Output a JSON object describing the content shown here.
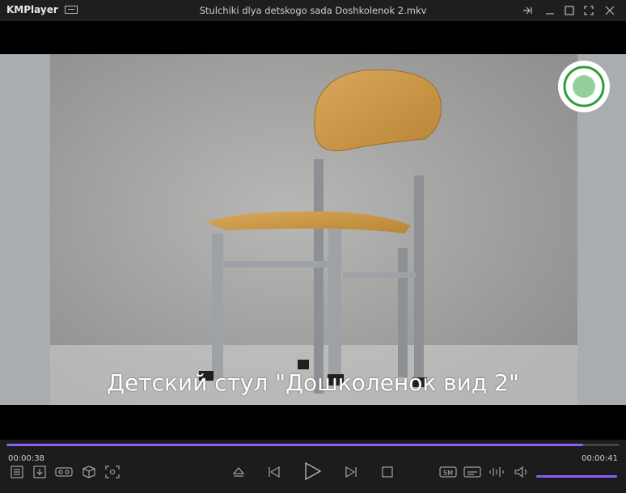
{
  "app": {
    "name": "KMPlayer",
    "file_title": "Stulchiki dlya detskogo sada Doshkolenok 2.mkv"
  },
  "video": {
    "subtitle": "Детский стул \"Дошколенок вид 2\""
  },
  "playback": {
    "elapsed": "00:00:38",
    "remaining": "00:00:41",
    "progress": 0.94,
    "volume": 1.0
  },
  "colors": {
    "accent": "#8a5cf0",
    "background": "#1c1c1c"
  },
  "icons": [
    "minimode-icon",
    "pin-icon",
    "minimize-icon",
    "maximize-icon",
    "fullscreen-icon",
    "close-icon",
    "playlist-icon",
    "download-icon",
    "vr-icon",
    "3d-icon",
    "capture-icon",
    "eject-icon",
    "previous-icon",
    "play-icon",
    "next-icon",
    "stop-icon",
    "speed-icon",
    "subtitle-icon",
    "equalizer-icon",
    "volume-icon"
  ]
}
